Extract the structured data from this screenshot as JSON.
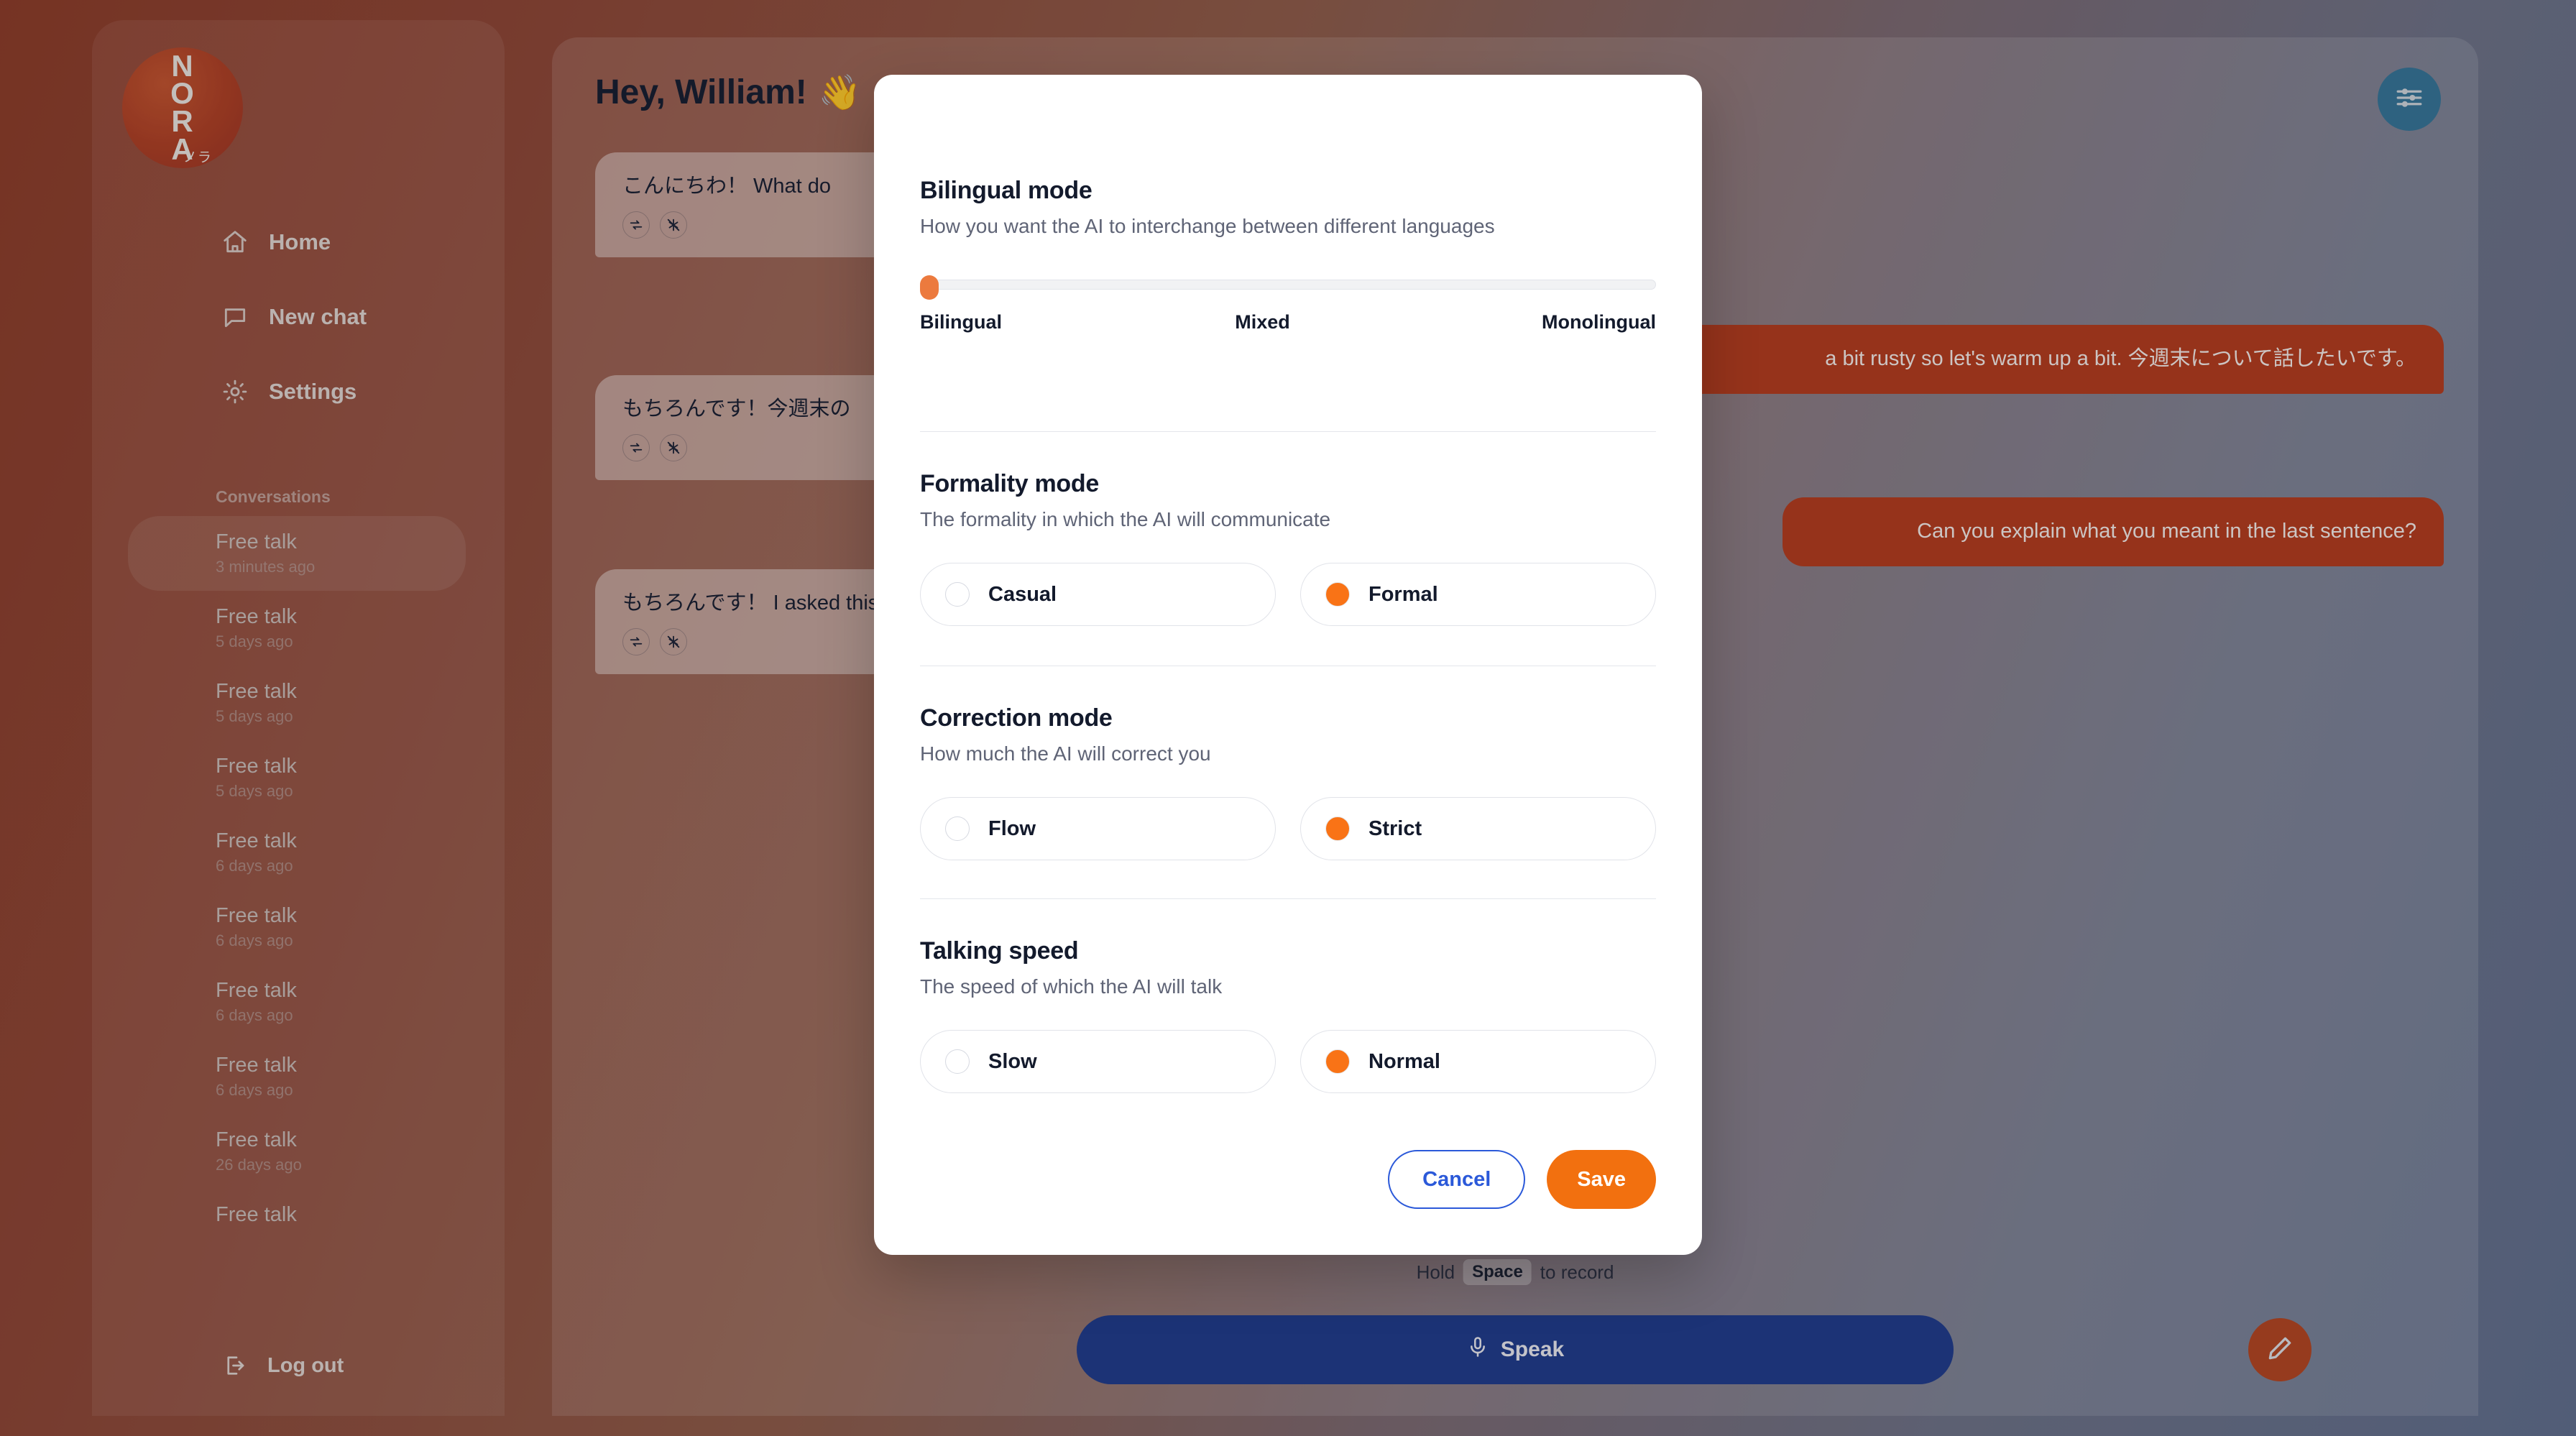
{
  "sidebar": {
    "logo": {
      "letters": [
        "N",
        "O",
        "R",
        "A"
      ],
      "kana": "ノラ"
    },
    "nav": [
      {
        "label": "Home",
        "icon": "home-icon"
      },
      {
        "label": "New chat",
        "icon": "chat-bubble-icon"
      },
      {
        "label": "Settings",
        "icon": "gear-icon"
      }
    ],
    "conversations_header": "Conversations",
    "conversations": [
      {
        "title": "Free talk",
        "time": "3 minutes ago",
        "active": true
      },
      {
        "title": "Free talk",
        "time": "5 days ago",
        "active": false
      },
      {
        "title": "Free talk",
        "time": "5 days ago",
        "active": false
      },
      {
        "title": "Free talk",
        "time": "5 days ago",
        "active": false
      },
      {
        "title": "Free talk",
        "time": "6 days ago",
        "active": false
      },
      {
        "title": "Free talk",
        "time": "6 days ago",
        "active": false
      },
      {
        "title": "Free talk",
        "time": "6 days ago",
        "active": false
      },
      {
        "title": "Free talk",
        "time": "6 days ago",
        "active": false
      },
      {
        "title": "Free talk",
        "time": "26 days ago",
        "active": false
      },
      {
        "title": "Free talk",
        "time": "",
        "active": false
      }
    ],
    "logout_label": "Log out"
  },
  "chat": {
    "greeting": "Hey, William!",
    "greeting_emoji": "👋",
    "settings_fab_icon": "sliders-icon",
    "messages": [
      {
        "role": "ai",
        "text": "こんにちわ！ What do"
      },
      {
        "role": "user",
        "text": "a bit rusty so let's warm up a bit. 今週末について話したいです。"
      },
      {
        "role": "ai",
        "text": "もちろんです！今週末の"
      },
      {
        "role": "user",
        "text": "Can you explain what you meant in the last sentence?"
      },
      {
        "role": "ai",
        "text": "もちろんです！ I asked this weekend?\" \"予定\""
      }
    ],
    "hint_prefix": "Hold",
    "hint_key": "Space",
    "hint_suffix": "to record",
    "speak_label": "Speak",
    "speak_icon": "microphone-icon",
    "edit_fab_icon": "pencil-icon"
  },
  "modal": {
    "bilingual": {
      "title": "Bilingual mode",
      "desc": "How you want the AI to interchange between different languages",
      "slider_labels": [
        "Bilingual",
        "Mixed",
        "Monolingual"
      ],
      "value": "Bilingual",
      "value_percent": 0
    },
    "formality": {
      "title": "Formality mode",
      "desc": "The formality in which the AI will communicate",
      "options": [
        {
          "label": "Casual",
          "selected": false
        },
        {
          "label": "Formal",
          "selected": true
        }
      ]
    },
    "correction": {
      "title": "Correction mode",
      "desc": "How much the AI will correct you",
      "options": [
        {
          "label": "Flow",
          "selected": false
        },
        {
          "label": "Strict",
          "selected": true
        }
      ]
    },
    "speed": {
      "title": "Talking speed",
      "desc": "The speed of which the AI will talk",
      "options": [
        {
          "label": "Slow",
          "selected": false
        },
        {
          "label": "Normal",
          "selected": true
        }
      ]
    },
    "cancel_label": "Cancel",
    "save_label": "Save"
  },
  "colors": {
    "accent_orange": "#f2700f",
    "radio_orange": "#f97316",
    "slider_orange": "#ec7a3e",
    "user_bubble": "#b33a1c",
    "speak_blue": "#1e3a8a",
    "cancel_blue": "#2b59d9",
    "fab_teal": "#2e7297",
    "edit_fab": "#b3441f"
  }
}
